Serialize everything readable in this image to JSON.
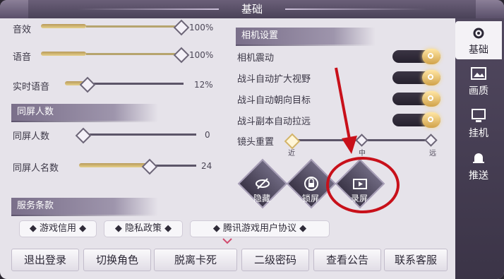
{
  "title": "基础",
  "audio": {
    "sound_effect": {
      "label": "音效",
      "value_text": "100%",
      "level": 1.0
    },
    "voice": {
      "label": "语音",
      "value_text": "100%",
      "level": 1.0
    },
    "realtime_voice": {
      "label": "实时语音",
      "value_text": "12%",
      "level": 0.12
    }
  },
  "same_screen": {
    "header": "同屏人数",
    "count": {
      "label": "同屏人数",
      "value_text": "0",
      "level": 0.0
    },
    "names": {
      "label": "同屏人名数",
      "value_text": "24",
      "level": 0.6
    }
  },
  "camera": {
    "header": "相机设置",
    "toggles": [
      {
        "label": "相机震动",
        "on": true
      },
      {
        "label": "战斗自动扩大视野",
        "on": true
      },
      {
        "label": "战斗自动朝向目标",
        "on": true
      },
      {
        "label": "战斗副本自动拉远",
        "on": true
      }
    ],
    "reset": {
      "label": "镜头重置",
      "ticks": [
        "近",
        "中",
        "远"
      ],
      "level": 0.0
    }
  },
  "action_buttons": [
    {
      "label": "隐藏",
      "icon": "eye-slash-icon"
    },
    {
      "label": "锁屏",
      "icon": "lock-icon"
    },
    {
      "label": "录屏",
      "icon": "record-screen-icon"
    }
  ],
  "terms": {
    "header": "服务条款",
    "items": [
      "游戏信用",
      "隐私政策",
      "腾讯游戏用户协议"
    ]
  },
  "bottom_buttons": [
    "退出登录",
    "切换角色",
    "脱离卡死",
    "二级密码",
    "查看公告",
    "联系客服"
  ],
  "tabs": [
    {
      "label": "基础",
      "icon": "gear-icon",
      "active": true
    },
    {
      "label": "画质",
      "icon": "picture-icon",
      "active": false
    },
    {
      "label": "挂机",
      "icon": "monitor-icon",
      "active": false
    },
    {
      "label": "推送",
      "icon": "bell-icon",
      "active": false
    }
  ],
  "colors": {
    "accent_gold": "#e5cf8a",
    "annotation_red": "#c8101a",
    "panel_bg": "#e6e3ea"
  }
}
